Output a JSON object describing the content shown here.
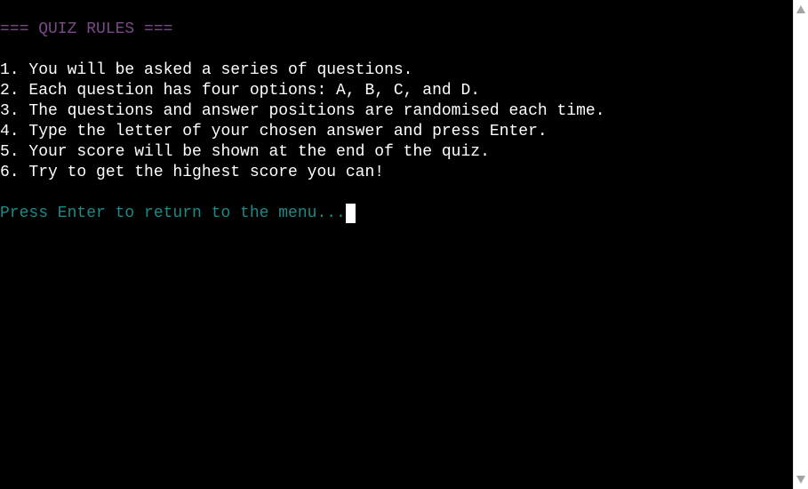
{
  "terminal": {
    "title": "=== QUIZ RULES ===",
    "rules": [
      "1. You will be asked a series of questions.",
      "2. Each question has four options: A, B, C, and D.",
      "3. The questions and answer positions are randomised each time.",
      "4. Type the letter of your chosen answer and press Enter.",
      "5. Your score will be shown at the end of the quiz.",
      "6. Try to get the highest score you can!"
    ],
    "prompt": "Press Enter to return to the menu..."
  },
  "colors": {
    "background": "#000000",
    "title": "#7a4a88",
    "text": "#ffffff",
    "prompt": "#1d8a86",
    "cursor": "#ffffff"
  }
}
